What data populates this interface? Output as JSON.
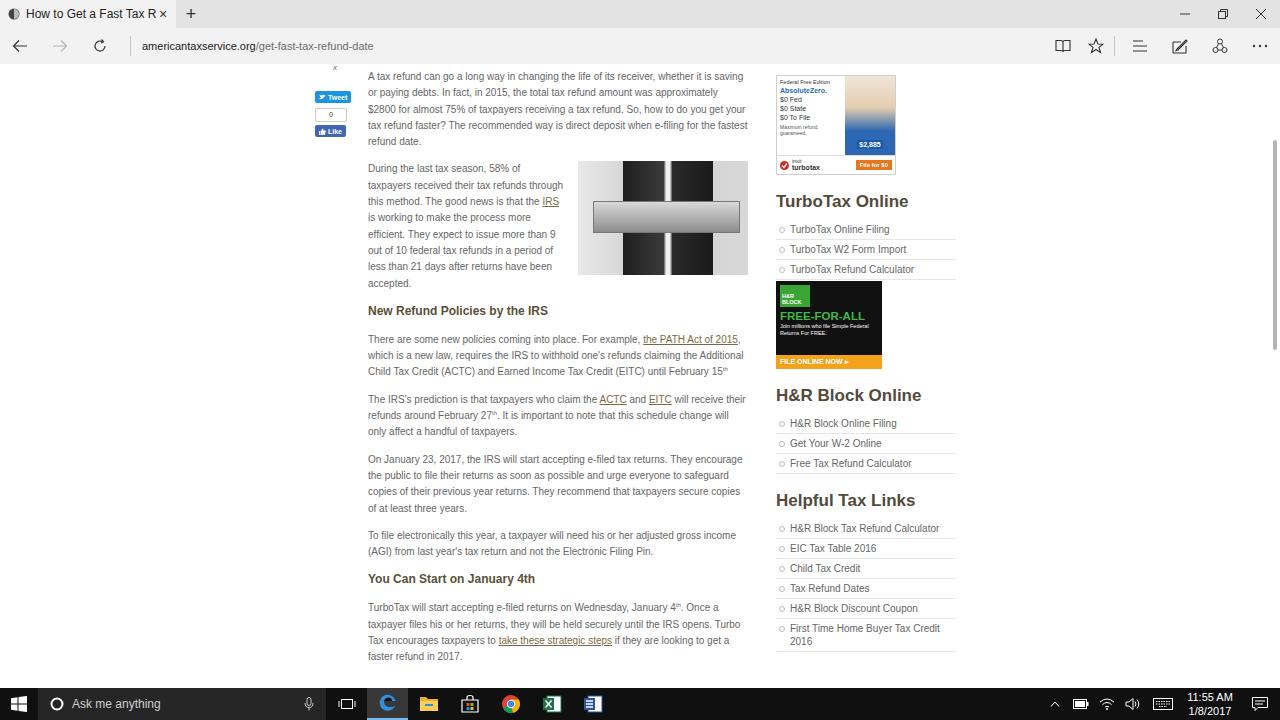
{
  "browser": {
    "tabs": [
      {
        "title": "How to Get a Fast Tax R",
        "close": "×",
        "selected": true
      }
    ],
    "new_tab": "+",
    "address": {
      "domain": "americantaxservice.org",
      "path": "/get-fast-tax-refund-date"
    },
    "forward_disabled": true
  },
  "page": {
    "share": {
      "close": "x",
      "tweet": "Tweet",
      "like_count": "0",
      "like": "Like"
    },
    "article": [
      {
        "kind": "p",
        "segments": [
          {
            "kind": "text",
            "text": "A tax refund can go a long way in changing the life of its receiver, whether it is saving or paying debts. In fact, in 2015, the total tax refund amount was approximately $2800 for almost 75% of taxpayers receiving a tax refund. So, how to do you get your tax refund faster? The recommended way is direct deposit when e-filing for the fastest refund date."
          }
        ]
      },
      {
        "kind": "image",
        "segments": []
      },
      {
        "kind": "p",
        "segments": [
          {
            "kind": "text",
            "text": "During the last tax season, 58% of taxpayers received their tax refunds through this method. The good news is that the "
          },
          {
            "kind": "link",
            "text": "IRS"
          },
          {
            "kind": "text",
            "text": " is working to make the process more efficient. They expect to issue more than 9 out of 10 federal tax refunds in a period of less than 21 days after returns have been accepted."
          }
        ]
      },
      {
        "kind": "h",
        "segments": [
          {
            "kind": "text",
            "text": "New Refund Policies by the IRS"
          }
        ]
      },
      {
        "kind": "p",
        "segments": [
          {
            "kind": "text",
            "text": "There are some new policies coming into place. For example, "
          },
          {
            "kind": "link",
            "text": "the PATH Act of 2015"
          },
          {
            "kind": "text",
            "text": ", which is a new law, requires the IRS to withhold one's refunds claiming the Additional Child Tax Credit (ACTC) and Earned Income Tax Credit (EITC) until February 15"
          },
          {
            "kind": "sup",
            "text": "th"
          }
        ]
      },
      {
        "kind": "p",
        "segments": [
          {
            "kind": "text",
            "text": "The IRS's prediction is that taxpayers who claim the "
          },
          {
            "kind": "link",
            "text": "ACTC"
          },
          {
            "kind": "text",
            "text": " and "
          },
          {
            "kind": "link",
            "text": "EITC"
          },
          {
            "kind": "text",
            "text": " will receive their refunds around February 27"
          },
          {
            "kind": "sup",
            "text": "th"
          },
          {
            "kind": "text",
            "text": ".  It is important to note that this schedule change will only affect a handful of taxpayers."
          }
        ]
      },
      {
        "kind": "p",
        "segments": [
          {
            "kind": "text",
            "text": "On January 23, 2017, the IRS will start accepting e-filed tax returns. They encourage the public to file their returns as soon as possible and urge everyone to safeguard copies of their previous year returns. They recommend that taxpayers secure copies of at least three years."
          }
        ]
      },
      {
        "kind": "p",
        "segments": [
          {
            "kind": "text",
            "text": "To file electronically this year, a taxpayer will need his or her adjusted gross income (AGI) from last year's tax return and not the Electronic Filing Pin."
          }
        ]
      },
      {
        "kind": "h",
        "segments": [
          {
            "kind": "text",
            "text": "You Can Start on January 4th"
          }
        ]
      },
      {
        "kind": "p",
        "segments": [
          {
            "kind": "text",
            "text": "TurboTax will start accepting e-filed returns on Wednesday, January 4"
          },
          {
            "kind": "sup",
            "text": "th"
          },
          {
            "kind": "text",
            "text": ". Once a taxpayer files his or her returns, they will be held securely until the IRS opens. Turbo Tax encourages taxpayers to "
          },
          {
            "kind": "link",
            "text": "take these strategic steps"
          },
          {
            "kind": "text",
            "text": " if they are looking to get a faster refund in 2017."
          }
        ]
      }
    ],
    "sidebar": [
      {
        "kind": "turbotax-ad",
        "title": "",
        "items": [],
        "ad": {
          "edition": "Federal Free Edition",
          "brand": "AbsoluteZero.",
          "lines": [
            "$0 Fed",
            "$0 State",
            "$0 To File"
          ],
          "note": "Maximum refund, guaranteed.",
          "amount": "$2,885",
          "maker": "intuit",
          "product": "turbotax",
          "button": "File for $0"
        }
      },
      {
        "kind": "links",
        "title": "TurboTax Online",
        "items": [
          "TurboTax Online Filing",
          "TurboTax W2 Form Import",
          "TurboTax Refund Calculator"
        ],
        "ad": null
      },
      {
        "kind": "hrblock-ad",
        "title": "",
        "items": [],
        "ad": {
          "logo": "H&R BLOCK",
          "headline": "FREE-FOR-ALL",
          "body": "Join millions who file Simple Federal Returns For FREE.",
          "button": "FILE ONLINE NOW ▸"
        }
      },
      {
        "kind": "links",
        "title": "H&R Block Online",
        "items": [
          "H&R Block Online Filing",
          "Get Your W-2 Online",
          "Free Tax Refund Calculator"
        ],
        "ad": null
      },
      {
        "kind": "links",
        "title": "Helpful Tax Links",
        "items": [
          "H&R Block Tax Refund Calculator",
          "EIC Tax Table 2016",
          "Child Tax Credit",
          "Tax Refund Dates",
          "H&R Block Discount Coupon",
          "First Time Home Buyer Tax Credit 2016"
        ],
        "ad": null
      }
    ],
    "scrollbar": {
      "thumb_start": 0.122,
      "thumb_size": 0.337
    }
  },
  "taskbar": {
    "search": {
      "placeholder": "Ask me anything"
    },
    "apps": [
      {
        "name": "edge",
        "selected": true
      },
      {
        "name": "explorer",
        "selected": false
      },
      {
        "name": "store",
        "selected": false
      },
      {
        "name": "chrome",
        "selected": false
      },
      {
        "name": "excel",
        "selected": false
      },
      {
        "name": "word",
        "selected": false
      }
    ],
    "clock": {
      "time": "11:55 AM",
      "date": "1/8/2017"
    }
  }
}
